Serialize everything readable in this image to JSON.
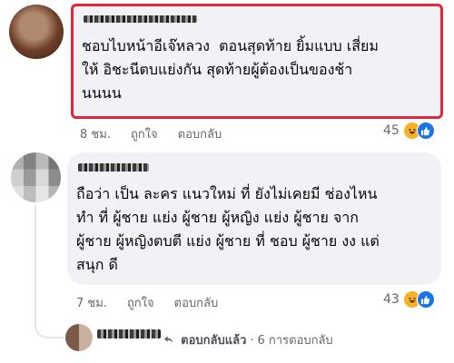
{
  "comments": [
    {
      "text": "ชอบไบหน้าอีเจ๊หลวง  ตอนสุดท้าย ยิ้มแบบ เสี่ยม\nให้ อิชะนีตบแย่งกัน สุดท้ายผู้ต้องเป็นของช้า\nนนนน",
      "time": "8 ชม.",
      "like_label": "ถูกใจ",
      "reply_label": "ตอบกลับ",
      "reaction_count": "45",
      "highlight_color": "#e3263a"
    },
    {
      "text": "ถือว่า เป็น ละคร แนวใหม่ ที่ ยังไม่เคยมี ช่องไหน\nทำ ที่ ผู้ชาย แย่ง ผู้ชาย ผู้หญิง แย่ง ผู้ชาย จาก\nผู้ชาย ผู้หญิงตบตี แย่ง ผู้ชาย ที่ ชอบ ผู้ชาย งง แต่\nสนุก ดี",
      "time": "7 ชม.",
      "like_label": "ถูกใจ",
      "reply_label": "ตอบกลับ",
      "reaction_count": "43"
    }
  ],
  "reply_summary": {
    "replied_label": "ตอบกลับแล้ว",
    "separator": "·",
    "count_label": "6 การตอบกลับ"
  },
  "icons": {
    "haha": "haha-reaction-icon",
    "like": "like-reaction-icon",
    "reply": "reply-arrow-icon"
  },
  "colors": {
    "bubble": "#f0f2f5",
    "meta_text": "#65676b",
    "like_blue": "#1b74e4",
    "haha_yellow": "#f7b125"
  }
}
